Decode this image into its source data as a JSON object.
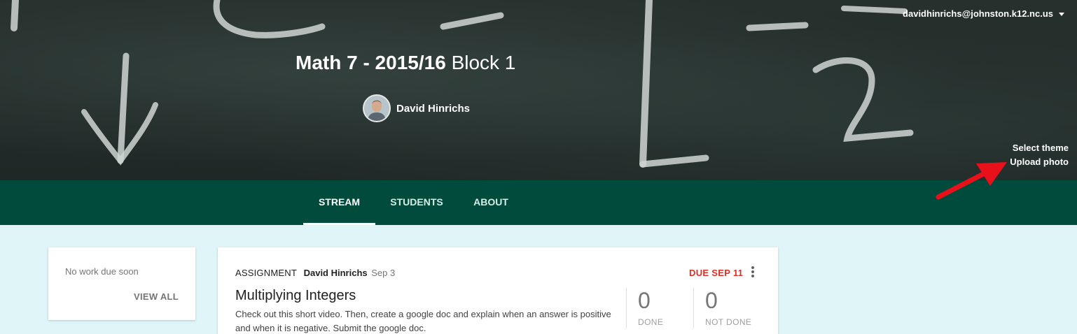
{
  "header": {
    "account_email": "davidhinrichs@johnston.k12.nc.us",
    "class_title_bold": "Math 7 - 2015/16",
    "class_title_section": "Block 1",
    "teacher_name": "David Hinrichs",
    "select_theme": "Select theme",
    "upload_photo": "Upload photo"
  },
  "tabs": [
    {
      "label": "STREAM",
      "active": true
    },
    {
      "label": "STUDENTS",
      "active": false
    },
    {
      "label": "ABOUT",
      "active": false
    }
  ],
  "upcoming": {
    "message": "No work due soon",
    "view_all": "VIEW ALL"
  },
  "post": {
    "type": "ASSIGNMENT",
    "author": "David Hinrichs",
    "date": "Sep 3",
    "due": "DUE SEP 11",
    "title": "Multiplying Integers",
    "body": "Check out this short video. Then, create a google doc and explain when an answer is positive and when it is negative. Submit the google doc.",
    "done_count": "0",
    "done_label": "DONE",
    "not_done_count": "0",
    "not_done_label": "NOT DONE"
  },
  "colors": {
    "tab_bar": "#014b3c",
    "page_bg": "#e0f5f8",
    "due_red": "#d93025",
    "annotation_arrow": "#e8111b"
  }
}
